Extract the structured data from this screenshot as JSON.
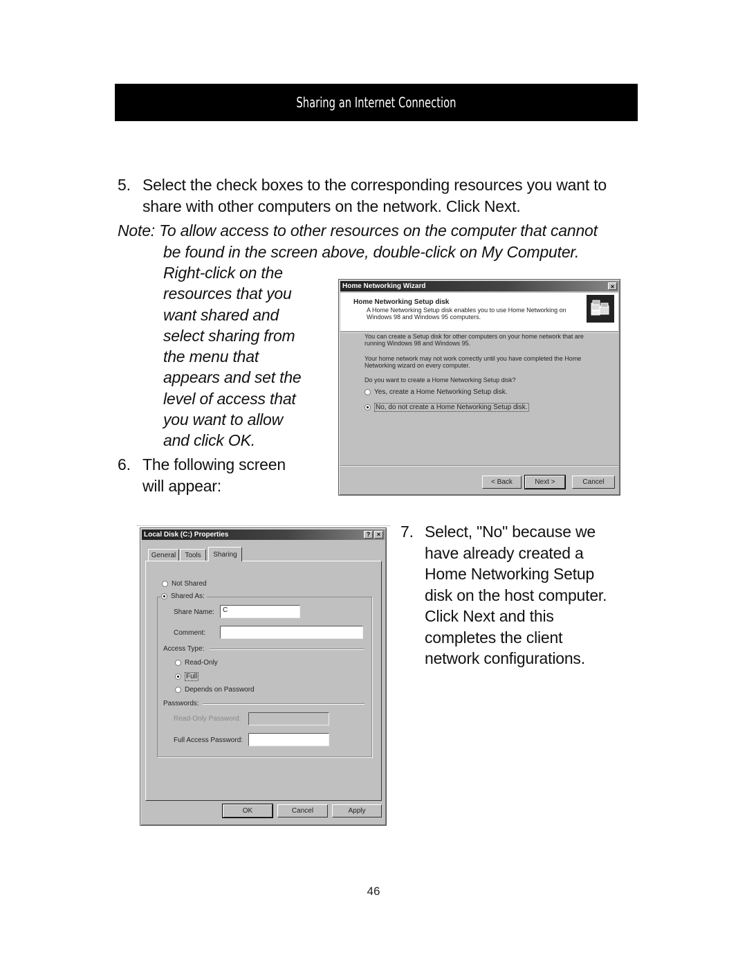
{
  "header": {
    "title": "Sharing an Internet Connection"
  },
  "steps": {
    "step5": {
      "number": "5.",
      "text": "Select the check boxes to the corresponding resources you want to share with other computers on the network. Click Next."
    },
    "note": {
      "lead": "Note: To allow access to other resources on the computer that cannot",
      "line2": "be found in the screen above, double-click on My Computer.",
      "column_lines": [
        "Right-click on the",
        "resources that you",
        "want shared and",
        "select sharing from",
        "the menu that",
        "appears and set the",
        "level of access that",
        "you want to allow",
        "and click OK."
      ]
    },
    "step6": {
      "number": "6.",
      "text": "The following screen will appear:"
    },
    "step7": {
      "number": "7.",
      "lines": [
        "Select, \"No\" because we",
        "have already created a",
        "Home Networking Setup",
        "disk on the host computer.",
        "Click Next and this",
        "completes the client",
        "network configurations."
      ]
    }
  },
  "wizard": {
    "title": "Home Networking Wizard",
    "close": "×",
    "heading": "Home Networking Setup disk",
    "subheading": "A Home Networking Setup disk enables you to use Home Networking on Windows 98 and Windows 95 computers.",
    "icon": "network-computers-icon",
    "paragraphs": [
      "You can create a Setup disk for other computers on your home network that are running Windows 98 and Windows 95.",
      "Your home network may not work correctly until you have completed the Home Networking wizard on every computer.",
      "Do you want to create a Home Networking Setup disk?"
    ],
    "options": [
      {
        "label": "Yes, create a Home Networking Setup disk.",
        "selected": false
      },
      {
        "label": "No, do not create a Home Networking Setup disk.",
        "selected": true
      }
    ],
    "buttons": {
      "back": "< Back",
      "next": "Next >",
      "cancel": "Cancel"
    }
  },
  "properties": {
    "title": "Local Disk (C:) Properties",
    "help": "?",
    "close": "×",
    "tabs": [
      "General",
      "Tools",
      "Sharing"
    ],
    "active_tab": "Sharing",
    "not_shared": {
      "label": "Not Shared",
      "selected": false
    },
    "shared_as": {
      "label": "Shared As:",
      "selected": true
    },
    "share_name": {
      "label": "Share Name:",
      "value": "C"
    },
    "comment": {
      "label": "Comment:",
      "value": ""
    },
    "access_type": {
      "label": "Access Type:",
      "options": [
        {
          "label": "Read-Only",
          "selected": false
        },
        {
          "label": "Full",
          "selected": true
        },
        {
          "label": "Depends on Password",
          "selected": false
        }
      ]
    },
    "passwords": {
      "label": "Passwords:",
      "read_only": {
        "label": "Read-Only Password:",
        "value": "",
        "disabled": true
      },
      "full_access": {
        "label": "Full Access Password:",
        "value": ""
      }
    },
    "buttons": {
      "ok": "OK",
      "cancel": "Cancel",
      "apply": "Apply"
    }
  },
  "page_number": "46"
}
